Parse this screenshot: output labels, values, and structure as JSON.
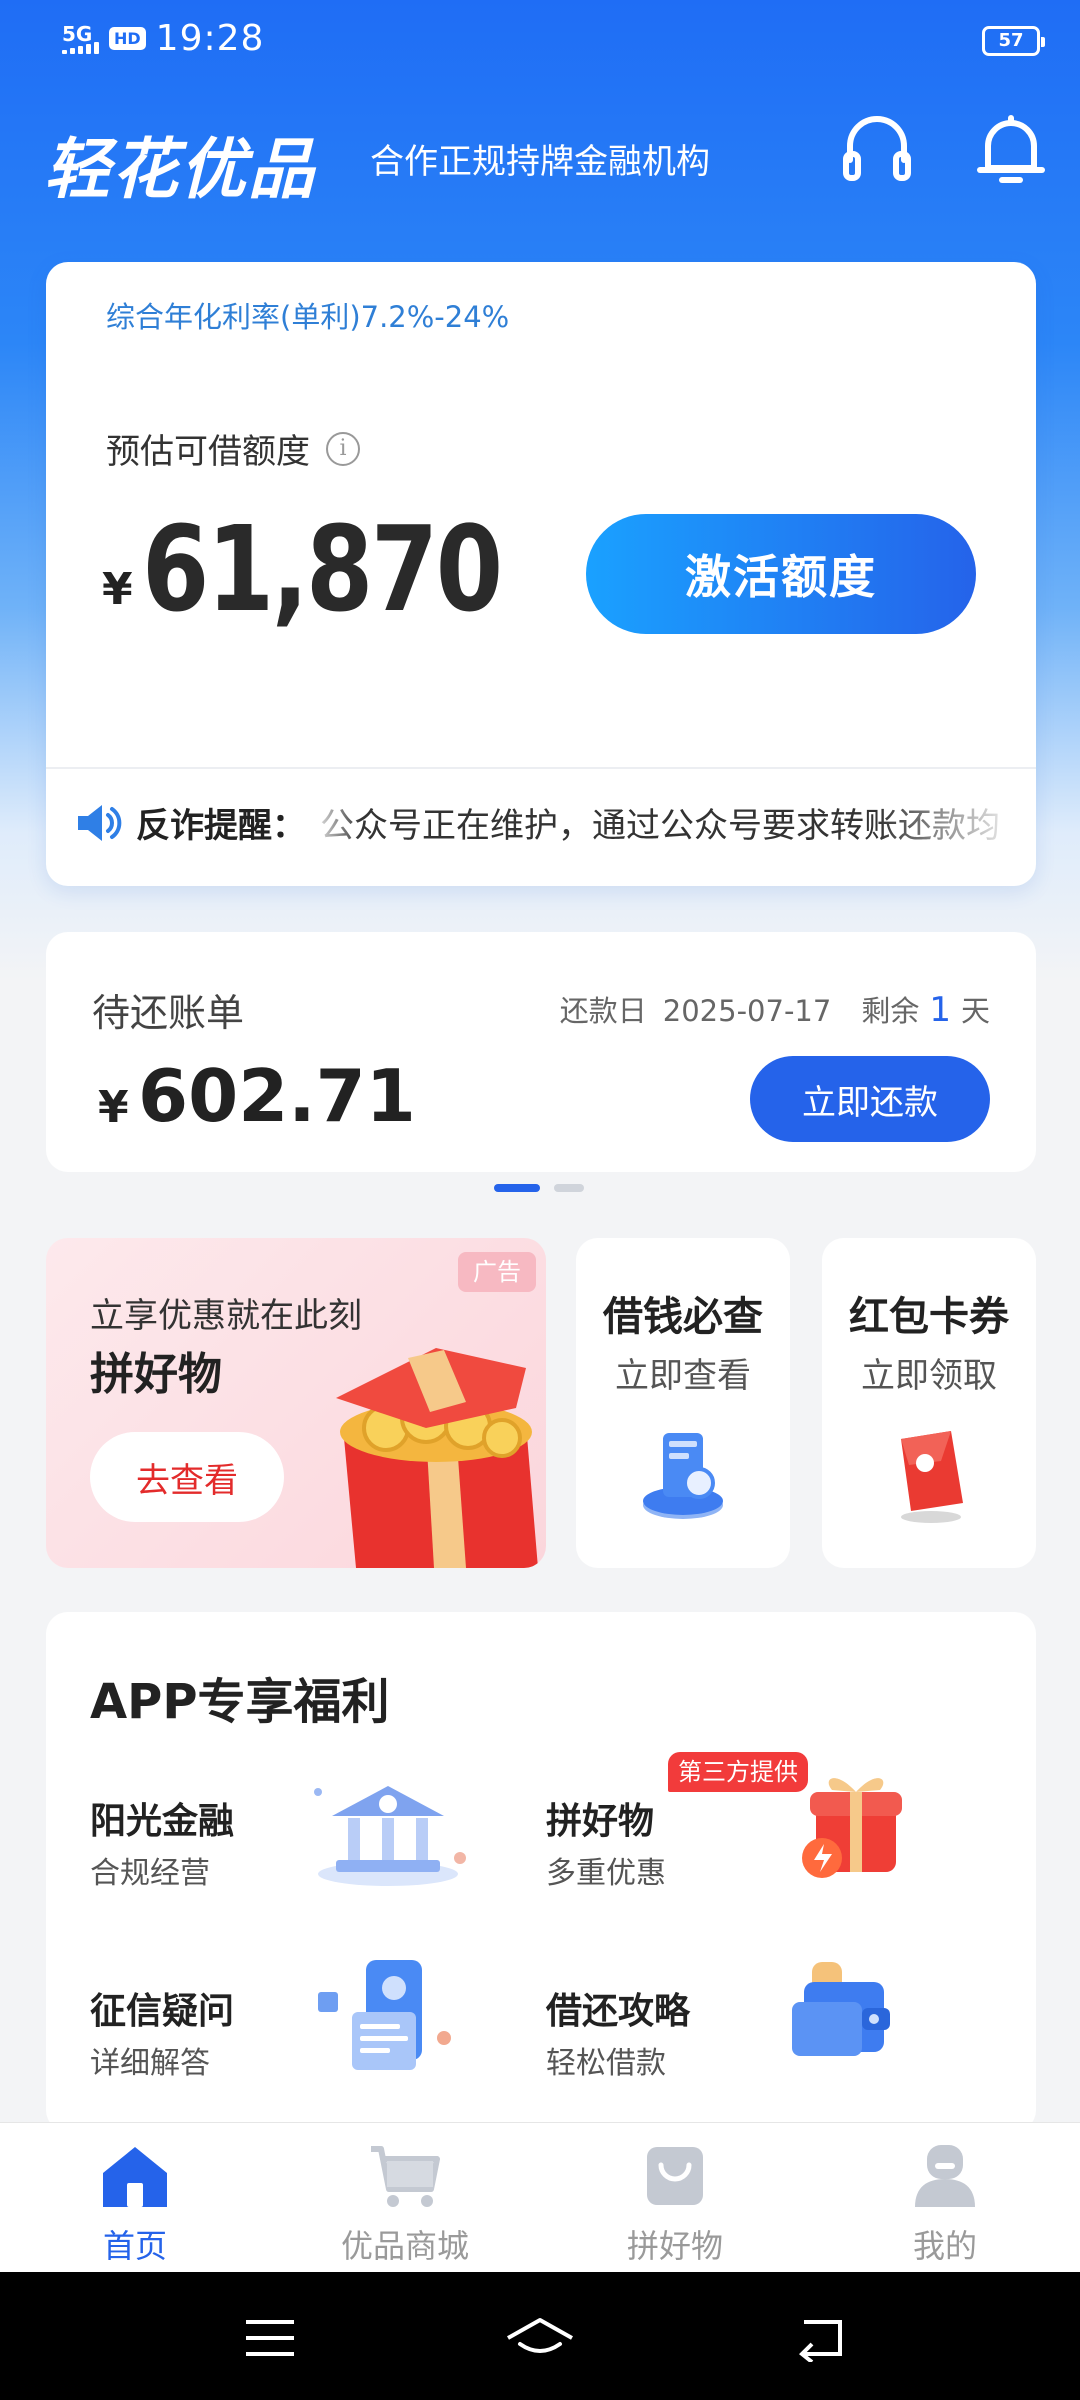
{
  "status_bar": {
    "network": "5G",
    "hd": "HD",
    "time": "19:28",
    "battery": "57"
  },
  "header": {
    "logo": "轻花优品",
    "slogan": "合作正规持牌金融机构"
  },
  "credit_card": {
    "rate": "综合年化利率(单利)7.2%-24%",
    "limit_label": "预估可借额度",
    "currency": "¥",
    "amount": "61,870",
    "activate_button": "激活额度",
    "notice_label": "反诈提醒：",
    "notice_text": "公众号正在维护，通过公众号要求转账还款均"
  },
  "bill": {
    "title": "待还账单",
    "due_label": "还款日",
    "due_date": "2025-07-17",
    "remaining_prefix": "剩余",
    "remaining_days": "1",
    "remaining_suffix": "天",
    "currency": "¥",
    "amount": "602.71",
    "repay_button": "立即还款"
  },
  "carousel": {
    "active_index": 0,
    "count": 2
  },
  "promos": {
    "main": {
      "badge": "广告",
      "subtitle": "立享优惠就在此刻",
      "title": "拼好物",
      "button": "去查看"
    },
    "loan_check": {
      "title": "借钱必查",
      "subtitle": "立即查看"
    },
    "coupons": {
      "title": "红包卡券",
      "subtitle": "立即领取"
    }
  },
  "benefits": {
    "title": "APP专享福利",
    "items": [
      {
        "name": "阳光金融",
        "desc": "合规经营"
      },
      {
        "name": "拼好物",
        "desc": "多重优惠",
        "badge": "第三方提供"
      },
      {
        "name": "征信疑问",
        "desc": "详细解答"
      },
      {
        "name": "借还攻略",
        "desc": "轻松借款"
      }
    ]
  },
  "tabbar": {
    "items": [
      {
        "label": "首页",
        "active": true
      },
      {
        "label": "优品商城",
        "active": false
      },
      {
        "label": "拼好物",
        "active": false
      },
      {
        "label": "我的",
        "active": false
      }
    ]
  },
  "colors": {
    "primary": "#2563ea",
    "header_blue": "#1f6df5",
    "rate_text": "#2f7fd6",
    "ad_red": "#e32b2b"
  }
}
